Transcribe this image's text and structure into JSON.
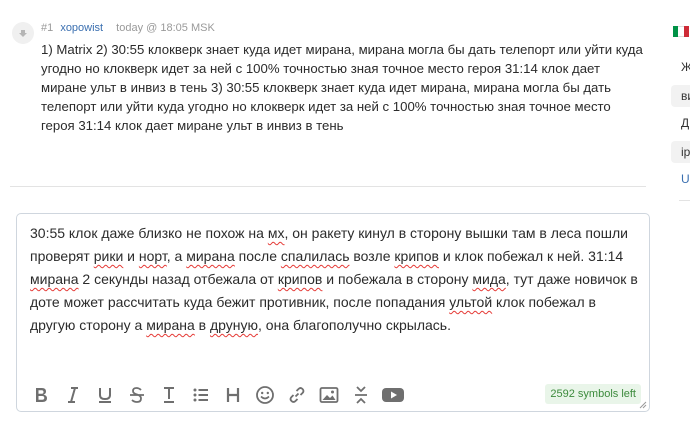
{
  "comment": {
    "number": "#1",
    "author": "xopowist",
    "timestamp": "today @ 18:05 MSK",
    "body": "1) Matrix 2) 30:55 клокверк знает куда идет мирана, мирана могла бы дать телепорт или уйти куда угодно но клокверк идет за ней с 100% точностью зная точное место героя 31:14 клок дает миране ульт в инвиз в тень 3) 30:55 клокверк знает куда идет мирана, мирана могла бы дать телепорт или уйти куда угодно но клокверк идет за ней с 100% точностью зная точное место героя 31:14 клок дает миране ульт в инвиз в тень"
  },
  "editor": {
    "segments": [
      {
        "text": "30:55 клок даже близко не похож на ",
        "err": false
      },
      {
        "text": "мх",
        "err": true
      },
      {
        "text": ", он ракету кинул в сторону вышки там в леса пошли проверят ",
        "err": false
      },
      {
        "text": "рики",
        "err": true
      },
      {
        "text": " и ",
        "err": false
      },
      {
        "text": "норт",
        "err": true
      },
      {
        "text": ", а ",
        "err": false
      },
      {
        "text": "мирана",
        "err": true
      },
      {
        "text": " после ",
        "err": false
      },
      {
        "text": "спалилась",
        "err": true
      },
      {
        "text": " возле ",
        "err": false
      },
      {
        "text": "крипов",
        "err": true
      },
      {
        "text": " и клок побежал к ней.  31:14 ",
        "err": false
      },
      {
        "text": "мирана",
        "err": true
      },
      {
        "text": " 2 секунды назад отбежала от ",
        "err": false
      },
      {
        "text": "крипов",
        "err": true
      },
      {
        "text": " и побежала в сторону ",
        "err": false
      },
      {
        "text": "мида",
        "err": true
      },
      {
        "text": ", тут даже новичок в доте может рассчитать куда бежит противник, после попадания ",
        "err": false
      },
      {
        "text": "ультой",
        "err": true
      },
      {
        "text": " клок побежал в другую сторону а ",
        "err": false
      },
      {
        "text": "мирана",
        "err": true
      },
      {
        "text": " в ",
        "err": false
      },
      {
        "text": "друную",
        "err": true
      },
      {
        "text": ", она благополучно скрылась.",
        "err": false
      }
    ],
    "counter": "2592 symbols left",
    "toolbar": [
      "bold-icon",
      "italic-icon",
      "underline-icon",
      "strikethrough-icon",
      "text-height-icon",
      "list-icon",
      "heading-icon",
      "smiley-icon",
      "link-icon",
      "image-icon",
      "collapse-icon",
      "youtube-icon"
    ]
  },
  "sidebar": {
    "items": [
      "Ж",
      "ви",
      "Д",
      "ip",
      "U"
    ]
  },
  "colors": {
    "author_link": "#3a6fb0",
    "counter_text": "#3d8b3d",
    "counter_bg": "#e9f5e9",
    "spell_error": "#e53935",
    "flag": [
      "#009246",
      "#ffffff",
      "#ce2b37"
    ]
  }
}
